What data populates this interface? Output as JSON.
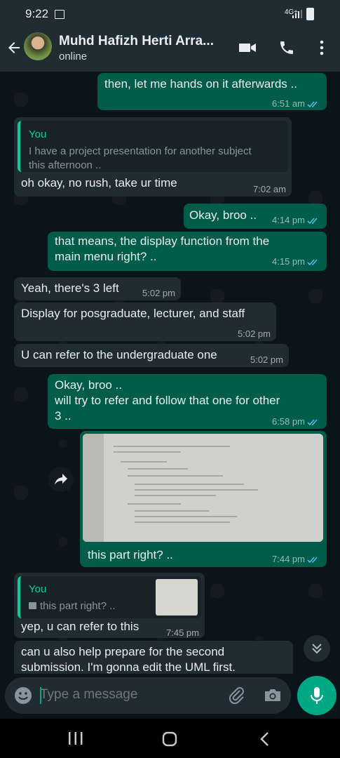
{
  "status_bar": {
    "time": "9:22",
    "network": "4G+"
  },
  "header": {
    "contact_name": "Muhd Hafizh Herti Arra...",
    "status": "online"
  },
  "messages": [
    {
      "dir": "out",
      "text": "then, let me hands on it afterwards ..",
      "time": "6:51 am"
    },
    {
      "dir": "in",
      "quote_author": "You",
      "quote_line1": "I have a project presentation for another subject",
      "quote_line2": "this afternoon ..",
      "text": "oh okay, no rush, take ur time",
      "time": "7:02 am"
    },
    {
      "dir": "out",
      "text": "Okay, broo ..",
      "time": "4:14 pm"
    },
    {
      "dir": "out",
      "line1": "that means, the display function from the",
      "line2": "main menu right? ..",
      "time": "4:15 pm"
    },
    {
      "dir": "in",
      "text": "Yeah, there's 3 left",
      "time": "5:02 pm"
    },
    {
      "dir": "in",
      "text": "Display for posgraduate, lecturer, and staff",
      "time": "5:02 pm"
    },
    {
      "dir": "in",
      "text": "U can refer to the undergraduate one",
      "time": "5:02 pm"
    },
    {
      "dir": "out",
      "line1": "Okay, broo ..",
      "line2": "will try to refer and follow that one for other",
      "line3": "3 ..",
      "time": "6:58 pm"
    },
    {
      "dir": "out",
      "type": "image",
      "caption": "this part right? ..",
      "time": "7:44 pm"
    },
    {
      "dir": "in",
      "quote_author": "You",
      "quote_text": "this part right? ..",
      "text": "yep, u can refer to this",
      "time": "7:45 pm"
    },
    {
      "dir": "in",
      "line1": "can u also help prepare for the second",
      "line2": "submission. I'm gonna edit the UML first."
    }
  ],
  "composer": {
    "placeholder": "Type a message"
  },
  "colors": {
    "outgoing": "#005c4b",
    "incoming": "#1f2c34",
    "accent": "#00a884",
    "read_tick": "#53bdeb"
  },
  "icons": [
    "back-arrow-icon",
    "video-call-icon",
    "phone-icon",
    "more-icon",
    "forward-icon",
    "scroll-down-icon",
    "emoji-icon",
    "attach-icon",
    "camera-icon",
    "mic-icon",
    "recent-apps-icon",
    "home-icon",
    "back-nav-icon"
  ]
}
